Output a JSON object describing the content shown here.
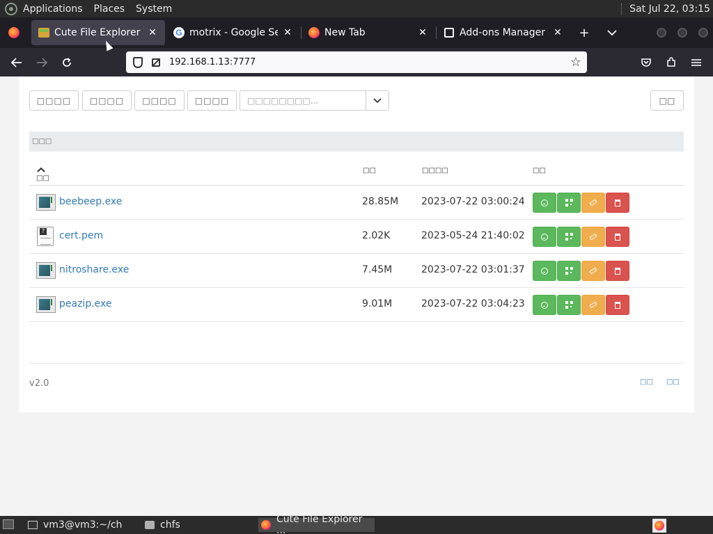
{
  "panel": {
    "menus": [
      "Applications",
      "Places",
      "System"
    ],
    "clock": "Sat Jul 22, 03:15"
  },
  "browser": {
    "tabs": [
      {
        "title": "Cute File Explorer",
        "icon": "chfs-favicon",
        "active": true
      },
      {
        "title": "motrix - Google Search",
        "icon": "google-icon",
        "active": false
      },
      {
        "title": "New Tab",
        "icon": "firefox-icon",
        "active": false
      },
      {
        "title": "Add-ons Manager",
        "icon": "puzzle-icon",
        "active": false
      }
    ],
    "new_tab_label": "+",
    "tab_list_label": "⌄",
    "url": "192.168.1.13:7777"
  },
  "page": {
    "toolbar_buttons": [
      "□□□□",
      "□□□□",
      "□□□□",
      "□□□□"
    ],
    "select_placeholder": "□□□□□□□□...",
    "right_button": "□□",
    "breadcrumb": "□□□",
    "columns": {
      "name": "□□",
      "size": "□□",
      "date": "□□□□",
      "actions": "□□"
    },
    "files": [
      {
        "name": "beebeep.exe",
        "size": "28.85M",
        "date": "2023-07-22 03:00:24",
        "type": "exe"
      },
      {
        "name": "cert.pem",
        "size": "2.02K",
        "date": "2023-05-24 21:40:02",
        "type": "doc"
      },
      {
        "name": "nitroshare.exe",
        "size": "7.45M",
        "date": "2023-07-22 03:01:37",
        "type": "exe"
      },
      {
        "name": "peazip.exe",
        "size": "9.01M",
        "date": "2023-07-22 03:04:23",
        "type": "exe"
      }
    ],
    "version": "v2.0",
    "footer_links": [
      "□□",
      "□□"
    ]
  },
  "taskbar": {
    "items": [
      {
        "label": "vm3@vm3:~/ch",
        "icon": "terminal-icon"
      },
      {
        "label": "chfs",
        "icon": "folder-icon"
      },
      {
        "label": "Cute File Explorer ...",
        "icon": "firefox-icon"
      }
    ]
  },
  "colors": {
    "link": "#337ab7",
    "success": "#5cb85c",
    "warning": "#f0ad4e",
    "danger": "#d9534f"
  }
}
